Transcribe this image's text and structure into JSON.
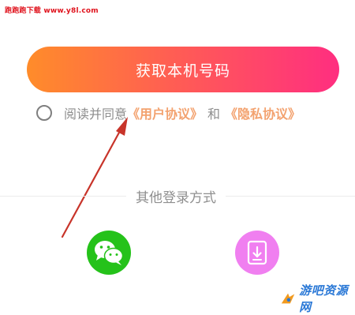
{
  "watermark_top": "跑跑跑下载 www.y8l.com",
  "primary_button": {
    "label": "获取本机号码"
  },
  "agreement": {
    "prefix": "阅读并同意",
    "user_agreement": "《用户协议》",
    "conjunction": "和",
    "privacy_policy": "《隐私协议》",
    "checked": false
  },
  "other_login": {
    "label": "其他登录方式",
    "options": [
      {
        "icon": "wechat-icon",
        "color": "#25c21a"
      },
      {
        "icon": "phone-download-icon",
        "color": "#f07ff0"
      }
    ]
  },
  "watermark_bottom": "游吧资源网",
  "annotation": {
    "type": "red-arrow",
    "color": "#c8342a"
  },
  "colors": {
    "button_gradient_start": "#ff8c2a",
    "button_gradient_end": "#ff2e80",
    "link": "#f3a26f",
    "text_muted": "#8d8d8d"
  }
}
